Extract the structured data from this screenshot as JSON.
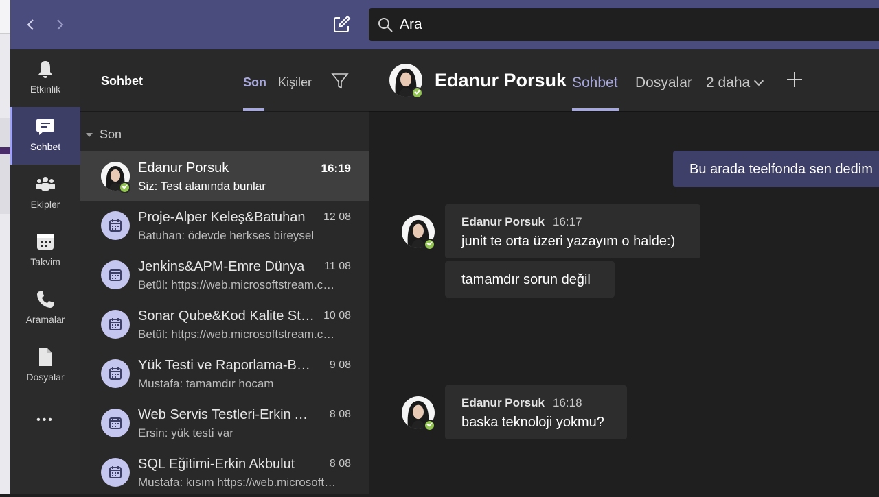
{
  "topbar": {
    "back_label": "‹",
    "forward_label": "›",
    "search_placeholder": "Ara"
  },
  "rail": {
    "items": [
      {
        "label": "Etkinlik",
        "icon": "bell-icon"
      },
      {
        "label": "Sohbet",
        "icon": "chat-icon"
      },
      {
        "label": "Ekipler",
        "icon": "teams-icon"
      },
      {
        "label": "Takvim",
        "icon": "calendar-icon"
      },
      {
        "label": "Aramalar",
        "icon": "phone-icon"
      },
      {
        "label": "Dosyalar",
        "icon": "file-icon"
      }
    ],
    "more_label": "•••"
  },
  "chatlist": {
    "title": "Sohbet",
    "tabs": [
      "Son",
      "Kişiler"
    ],
    "section": "Son",
    "items": [
      {
        "name": "Edanur Porsuk",
        "time": "16:19",
        "preview": "Siz: Test alanında bunlar",
        "type": "person"
      },
      {
        "name": "Proje-Alper Keleş&Batuhan",
        "time": "12 08",
        "preview": "Batuhan: ödevde herkses bireysel",
        "type": "meeting"
      },
      {
        "name": "Jenkins&APM-Emre Dünya",
        "time": "11 08",
        "preview": "Betül: https://web.microsoftstream.com",
        "type": "meeting"
      },
      {
        "name": "Sonar Qube&Kod Kalite Standartları",
        "time": "10 08",
        "preview": "Betül: https://web.microsoftstream.com",
        "type": "meeting"
      },
      {
        "name": "Yük Testi ve Raporlama-Batuhan",
        "time": "9 08",
        "preview": "Mustafa: tamamdır hocam",
        "type": "meeting"
      },
      {
        "name": "Web Servis Testleri-Erkin Akbulut",
        "time": "8 08",
        "preview": "Ersin: yük testi var",
        "type": "meeting"
      },
      {
        "name": "SQL Eğitimi-Erkin Akbulut",
        "time": "8 08",
        "preview": "Mustafa: kısım https://web.microsoftstream.com",
        "type": "meeting"
      }
    ]
  },
  "conversation": {
    "name": "Edanur Porsuk",
    "tabs": [
      "Sohbet",
      "Dosyalar"
    ],
    "more_tabs": "2 daha",
    "messages": [
      {
        "mine": true,
        "text": "Bu arada teelfonda sen dedim"
      },
      {
        "mine": false,
        "author": "Edanur Porsuk",
        "time": "16:17",
        "text": "junit te orta üzeri yazayım o halde:)"
      },
      {
        "mine": false,
        "text": "tamamdır sorun değil"
      },
      {
        "mine": false,
        "author": "Edanur Porsuk",
        "time": "16:18",
        "text": "baska teknoloji yokmu?"
      }
    ]
  },
  "colors": {
    "accent": "#a6a7dc",
    "topbar": "#4b4c7e",
    "presence_available": "#92c353"
  }
}
